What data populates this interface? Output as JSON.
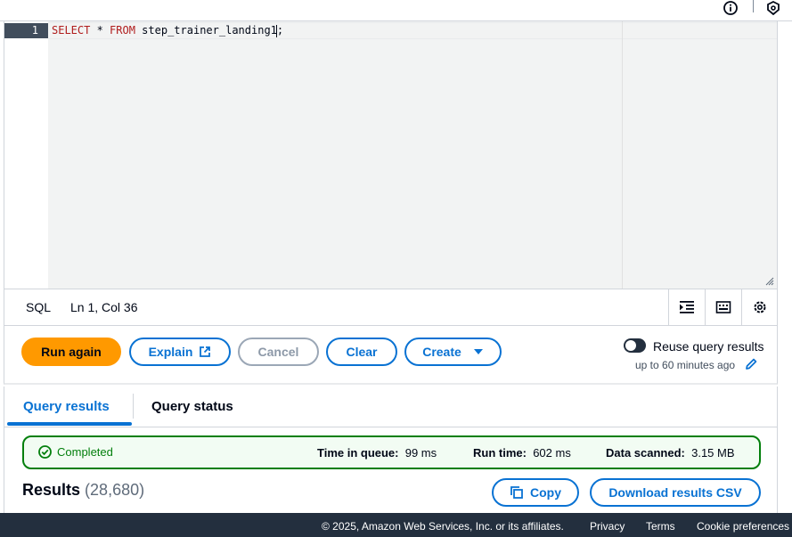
{
  "editor": {
    "line_number": "1",
    "code": {
      "kw1": "SELECT",
      "mid": " * ",
      "kw2": "FROM",
      "rest": " step_trainer_landing1;"
    }
  },
  "status_bar": {
    "language": "SQL",
    "position": "Ln 1, Col 36"
  },
  "toolbar": {
    "run_label": "Run again",
    "explain_label": "Explain",
    "cancel_label": "Cancel",
    "clear_label": "Clear",
    "create_label": "Create",
    "reuse_label": "Reuse query results",
    "reuse_sub": "up to 60 minutes ago",
    "reuse_enabled": false
  },
  "tabs": [
    {
      "label": "Query results",
      "active": true
    },
    {
      "label": "Query status",
      "active": false
    }
  ],
  "result_status": {
    "status": "Completed",
    "time_in_queue_label": "Time in queue:",
    "time_in_queue_value": "99 ms",
    "run_time_label": "Run time:",
    "run_time_value": "602 ms",
    "data_scanned_label": "Data scanned:",
    "data_scanned_value": "3.15 MB"
  },
  "results": {
    "title": "Results",
    "count": "(28,680)",
    "copy_label": "Copy",
    "download_label": "Download results CSV"
  },
  "footer": {
    "copyright": "© 2025, Amazon Web Services, Inc. or its affiliates.",
    "privacy": "Privacy",
    "terms": "Terms",
    "cookies": "Cookie preferences"
  },
  "colors": {
    "primary": "#ff9900",
    "link": "#0972d3",
    "success": "#037f0c",
    "footer_bg": "#232f3e"
  }
}
